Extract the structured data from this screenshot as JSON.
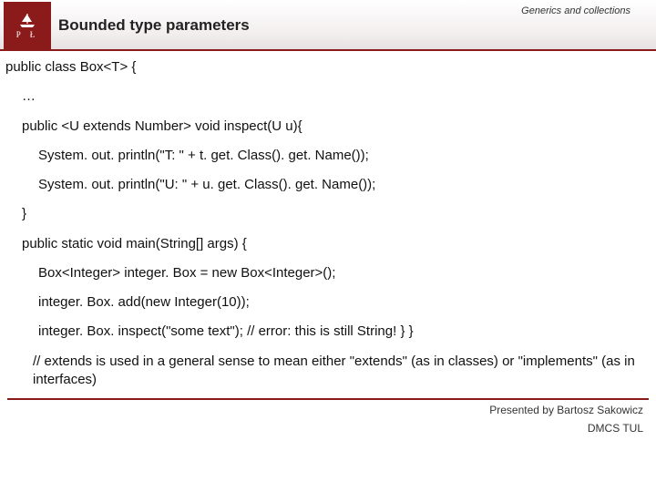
{
  "header": {
    "topic": "Generics and collections",
    "title": "Bounded type parameters",
    "logo_letters": "P   Ł"
  },
  "code": {
    "l1": "public class Box<T> {",
    "l2": "…",
    "l3": "public <U extends Number> void inspect(U u){",
    "l4": "System. out. println(\"T: \" + t. get. Class(). get. Name());",
    "l5": "System. out. println(\"U: \" + u. get. Class(). get. Name());",
    "l6": "}",
    "l7": "public static void main(String[] args) {",
    "l8": "Box<Integer> integer. Box = new Box<Integer>();",
    "l9": "integer. Box. add(new Integer(10));",
    "l10": "integer. Box. inspect(\"some text\"); // error: this is still String!  } }",
    "l11": "// extends is used in a general sense to mean either \"extends\" (as in classes) or \"implements\" (as in interfaces)"
  },
  "footer": {
    "presenter": "Presented by Bartosz Sakowicz",
    "org": "DMCS TUL"
  }
}
